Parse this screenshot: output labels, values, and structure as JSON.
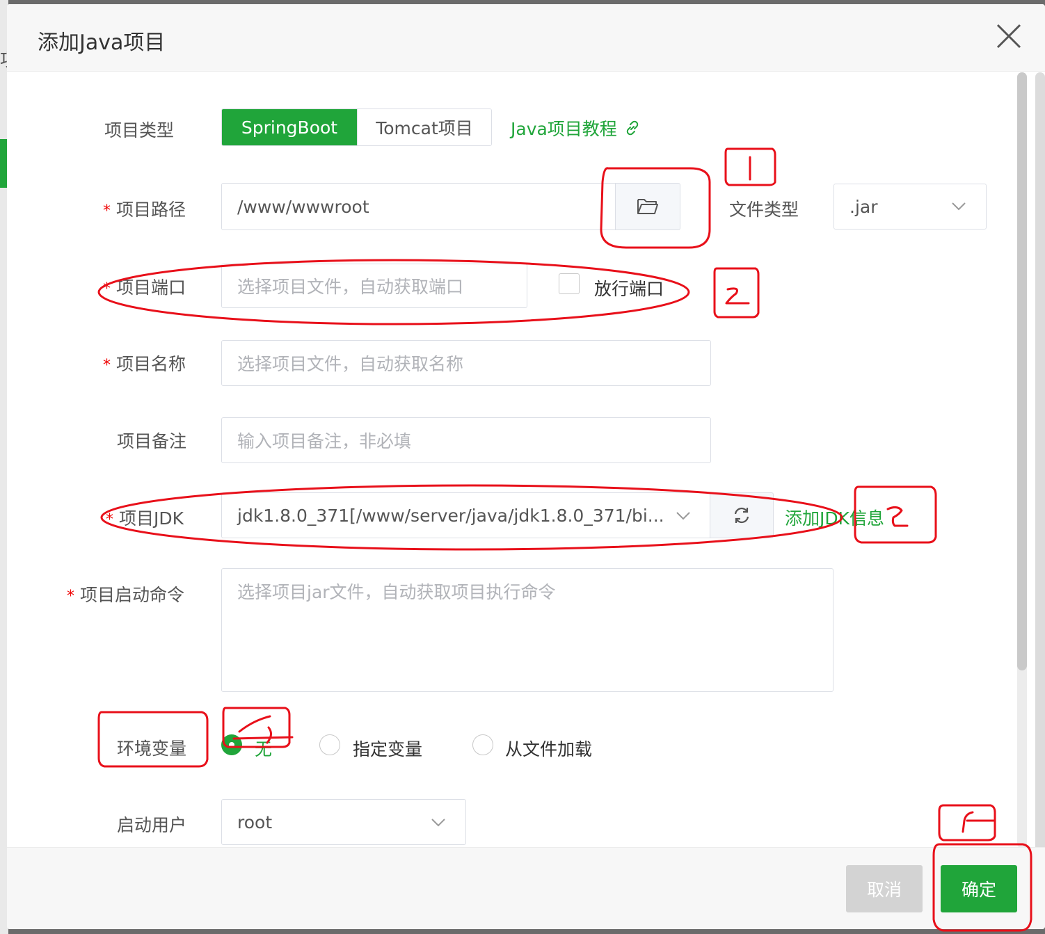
{
  "dialog": {
    "title": "添加Java项目"
  },
  "bg": {
    "fragment": "项"
  },
  "form": {
    "project_type": {
      "label": "项目类型",
      "options": [
        "SpringBoot",
        "Tomcat项目"
      ],
      "selected": "SpringBoot",
      "tutorial_link": "Java项目教程"
    },
    "project_path": {
      "label": "项目路径",
      "required": "*",
      "value": "/www/wwwroot"
    },
    "file_type": {
      "label": "文件类型",
      "value": ".jar"
    },
    "project_port": {
      "label": "项目端口",
      "required": "*",
      "placeholder": "选择项目文件，自动获取端口",
      "open_port_label": "放行端口"
    },
    "project_name": {
      "label": "项目名称",
      "required": "*",
      "placeholder": "选择项目文件，自动获取名称"
    },
    "project_note": {
      "label": "项目备注",
      "placeholder": "输入项目备注，非必填"
    },
    "project_jdk": {
      "label": "项目JDK",
      "required": "*",
      "value": "jdk1.8.0_371[/www/server/java/jdk1.8.0_371/bi...",
      "add_link": "添加JDK信息"
    },
    "start_command": {
      "label": "项目启动命令",
      "required": "*",
      "placeholder": "选择项目jar文件，自动获取项目执行命令"
    },
    "env": {
      "label": "环境变量",
      "options": [
        "无",
        "指定变量",
        "从文件加载"
      ],
      "selected": "无"
    },
    "start_user": {
      "label": "启动用户",
      "value": "root"
    }
  },
  "footer": {
    "cancel": "取消",
    "confirm": "确定"
  },
  "colors": {
    "accent": "#20a53a",
    "required": "#ef0808",
    "annotation": "#e8101a"
  }
}
